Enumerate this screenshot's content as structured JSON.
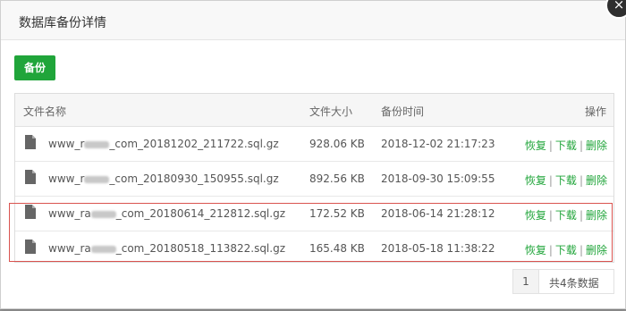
{
  "dialog": {
    "title": "数据库备份详情",
    "close_icon": "×",
    "backup_button": "备份"
  },
  "table": {
    "headers": {
      "name": "文件名称",
      "size": "文件大小",
      "time": "备份时间",
      "ops": "操作"
    },
    "rows": [
      {
        "name_prefix": "www_r",
        "name_suffix": "_com_20181202_211722.sql.gz",
        "size": "928.06 KB",
        "time": "2018-12-02 21:17:23"
      },
      {
        "name_prefix": "www_r",
        "name_suffix": "_com_20180930_150955.sql.gz",
        "size": "892.56 KB",
        "time": "2018-09-30 15:09:55"
      },
      {
        "name_prefix": "www_ra",
        "name_suffix": "_com_20180614_212812.sql.gz",
        "size": "172.52 KB",
        "time": "2018-06-14 21:28:12"
      },
      {
        "name_prefix": "www_ra",
        "name_suffix": "_com_20180518_113822.sql.gz",
        "size": "165.48 KB",
        "time": "2018-05-18 11:38:22"
      }
    ],
    "ops": {
      "restore": "恢复",
      "download": "下载",
      "delete": "删除",
      "sep": "|"
    }
  },
  "pager": {
    "page": "1",
    "total": "共4条数据"
  },
  "colors": {
    "accent": "#20a53a",
    "highlight": "#d9534f"
  }
}
